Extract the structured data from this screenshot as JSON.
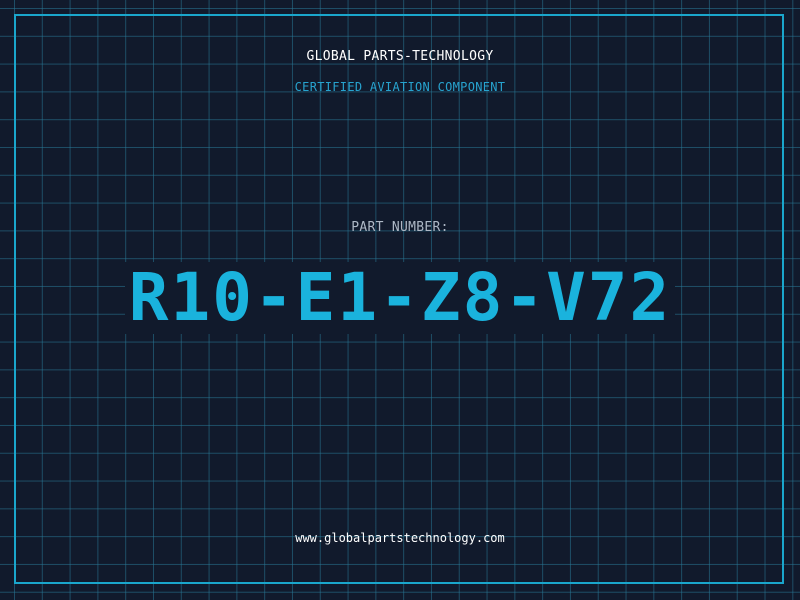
{
  "header": {
    "company": "GLOBAL PARTS-TECHNOLOGY",
    "subtitle": "CERTIFIED AVIATION COMPONENT"
  },
  "part": {
    "label": "PART NUMBER:",
    "number": "R10-E1-Z8-V72"
  },
  "footer": {
    "url": "www.globalpartstechnology.com"
  },
  "colors": {
    "background": "#111a2c",
    "grid": "#287896",
    "frame": "#1aa6cc",
    "accent": "#1ab3dd",
    "label": "#aeb8c6",
    "text": "#ffffff"
  }
}
